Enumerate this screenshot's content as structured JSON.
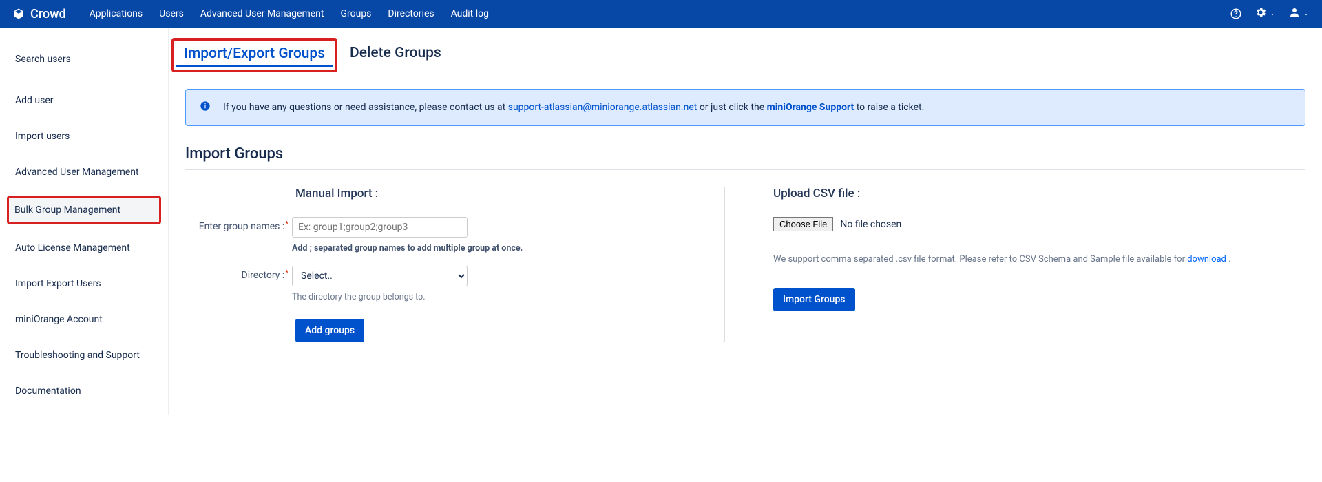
{
  "brand": "Crowd",
  "topnav": [
    "Applications",
    "Users",
    "Advanced User Management",
    "Groups",
    "Directories",
    "Audit log"
  ],
  "sidebar": {
    "items": [
      "Search users",
      "Add user",
      "Import users",
      "Advanced User Management",
      "Bulk Group Management",
      "Auto License Management",
      "Import Export Users",
      "miniOrange Account",
      "Troubleshooting and Support",
      "Documentation"
    ]
  },
  "tabs": {
    "active": "Import/Export Groups",
    "other": "Delete Groups"
  },
  "banner": {
    "prefix": "If you have any questions or need assistance, please contact us at ",
    "email": "support-atlassian@miniorange.atlassian.net",
    "mid": " or just click the ",
    "bold": "miniOrange Support",
    "suffix": " to raise a ticket."
  },
  "sectionHeading": "Import Groups",
  "manual": {
    "title": "Manual Import :",
    "groupLabel": "Enter group names :",
    "groupPlaceholder": "Ex: group1;group2;group3",
    "groupHint": "Add ; separated group names to add multiple group at once.",
    "dirLabel": "Directory :",
    "dirSelected": "Select..",
    "dirHint": "The directory the group belongs to.",
    "button": "Add groups"
  },
  "upload": {
    "title": "Upload CSV file :",
    "choose": "Choose File",
    "nofile": "No file chosen",
    "note1": "We support comma separated .csv file format. Please refer to CSV Schema and Sample file available for ",
    "download": "download",
    "dot": " .",
    "button": "Import Groups"
  }
}
